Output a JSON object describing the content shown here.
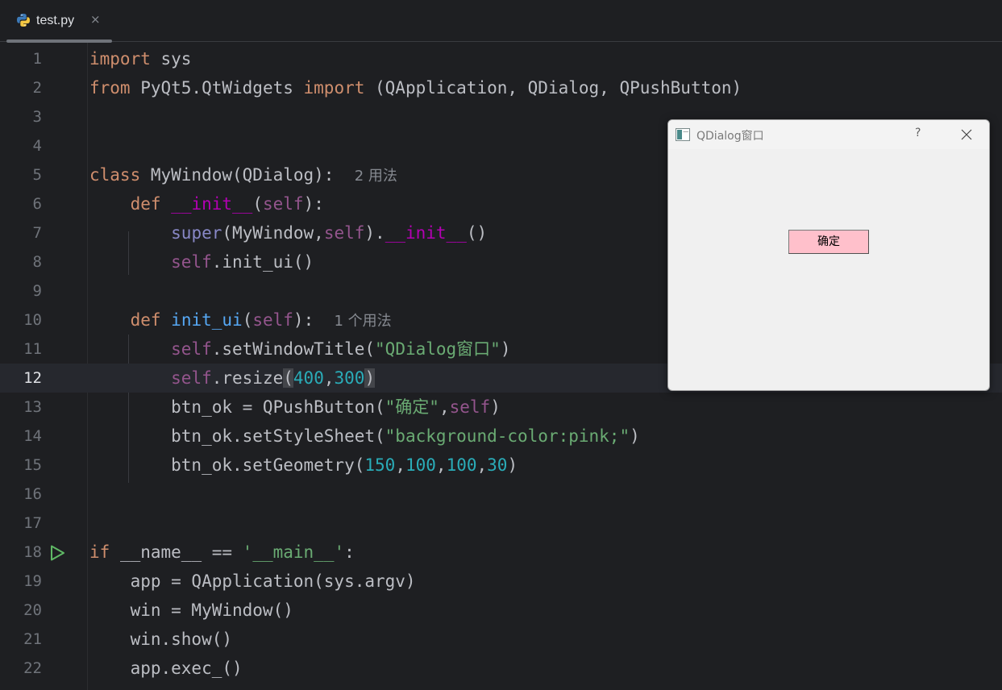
{
  "tab": {
    "filename": "test.py",
    "close_glyph": "×",
    "icon": "python-icon"
  },
  "editor": {
    "current_line": 12,
    "lines": [
      {
        "n": "1",
        "text": "import sys"
      },
      {
        "n": "2",
        "text": "from PyQt5.QtWidgets import (QApplication, QDialog, QPushButton)"
      },
      {
        "n": "3",
        "text": ""
      },
      {
        "n": "4",
        "text": ""
      },
      {
        "n": "5",
        "text": "class MyWindow(QDialog):",
        "hint": "2 用法"
      },
      {
        "n": "6",
        "text": "    def __init__(self):"
      },
      {
        "n": "7",
        "text": "        super(MyWindow,self).__init__()"
      },
      {
        "n": "8",
        "text": "        self.init_ui()"
      },
      {
        "n": "9",
        "text": ""
      },
      {
        "n": "10",
        "text": "    def init_ui(self):",
        "hint": "1 个用法"
      },
      {
        "n": "11",
        "text": "        self.setWindowTitle(\"QDialog窗口\")"
      },
      {
        "n": "12",
        "text": "        self.resize(400,300)"
      },
      {
        "n": "13",
        "text": "        btn_ok = QPushButton(\"确定\",self)"
      },
      {
        "n": "14",
        "text": "        btn_ok.setStyleSheet(\"background-color:pink;\")"
      },
      {
        "n": "15",
        "text": "        btn_ok.setGeometry(150,100,100,30)"
      },
      {
        "n": "16",
        "text": ""
      },
      {
        "n": "17",
        "text": ""
      },
      {
        "n": "18",
        "text": "if __name__ == '__main__':",
        "run_icon": "run-icon"
      },
      {
        "n": "19",
        "text": "    app = QApplication(sys.argv)"
      },
      {
        "n": "20",
        "text": "    win = MyWindow()"
      },
      {
        "n": "21",
        "text": "    win.show()"
      },
      {
        "n": "22",
        "text": "    app.exec_()"
      }
    ]
  },
  "dialog": {
    "title": "QDialog窗口",
    "help_label": "?",
    "close_icon": "close-icon",
    "button_label": "确定",
    "button_color": "#ffc0cb"
  },
  "colors": {
    "background": "#1e1f22",
    "keyword": "#cf8e6d",
    "function": "#56a8f5",
    "self": "#94558d",
    "string": "#6aab73",
    "number": "#2aacb8",
    "magic": "#b200b2"
  }
}
